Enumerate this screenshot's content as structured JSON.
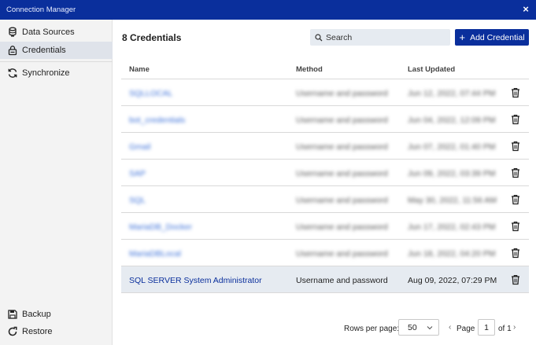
{
  "window": {
    "title": "Connection Manager",
    "close_glyph": "×"
  },
  "sidebar": {
    "items": [
      {
        "label": "Data Sources",
        "icon": "database-icon"
      },
      {
        "label": "Credentials",
        "icon": "lock-icon",
        "active": true
      },
      {
        "label": "Synchronize",
        "icon": "sync-icon"
      }
    ],
    "bottom_items": [
      {
        "label": "Backup",
        "icon": "save-icon"
      },
      {
        "label": "Restore",
        "icon": "restore-icon"
      }
    ]
  },
  "main": {
    "heading": "8 Credentials",
    "search": {
      "placeholder": "Search",
      "value": ""
    },
    "add_button": {
      "label": "Add Credential",
      "glyph": "+"
    },
    "table": {
      "columns": [
        "Name",
        "Method",
        "Last Updated"
      ],
      "rows": [
        {
          "name": "SQLLOCAL",
          "method": "Username and password",
          "date": "Jun 12, 2022, 07:44 PM",
          "blurred": true
        },
        {
          "name": "bot_credentials",
          "method": "Username and password",
          "date": "Jun 04, 2022, 12:09 PM",
          "blurred": true
        },
        {
          "name": "Gmail",
          "method": "Username and password",
          "date": "Jun 07, 2022, 01:40 PM",
          "blurred": true
        },
        {
          "name": "SAP",
          "method": "Username and password",
          "date": "Jun 09, 2022, 03:39 PM",
          "blurred": true
        },
        {
          "name": "SQL",
          "method": "Username and password",
          "date": "May 30, 2022, 11:56 AM",
          "blurred": true
        },
        {
          "name": "MariaDB_Docker",
          "method": "Username and password",
          "date": "Jun 17, 2022, 02:43 PM",
          "blurred": true
        },
        {
          "name": "MariaDBLocal",
          "method": "Username and password",
          "date": "Jun 18, 2022, 04:20 PM",
          "blurred": true
        },
        {
          "name": "SQL SERVER System Administrator",
          "method": "Username and password",
          "date": "Aug 09, 2022, 07:29 PM",
          "blurred": false,
          "selected": true
        }
      ]
    },
    "pagination": {
      "rows_per_page_label": "Rows per page:",
      "rows_per_page_value": "50",
      "prev_glyph": "‹",
      "page_label": "Page",
      "page_value": "1",
      "of_label": "of 1",
      "next_glyph": "›"
    }
  },
  "colors": {
    "accent": "#0a2f9c",
    "link": "#2c5bc8",
    "selected_row": "#e6ebf1",
    "sidebar_bg": "#f3f3f3"
  }
}
